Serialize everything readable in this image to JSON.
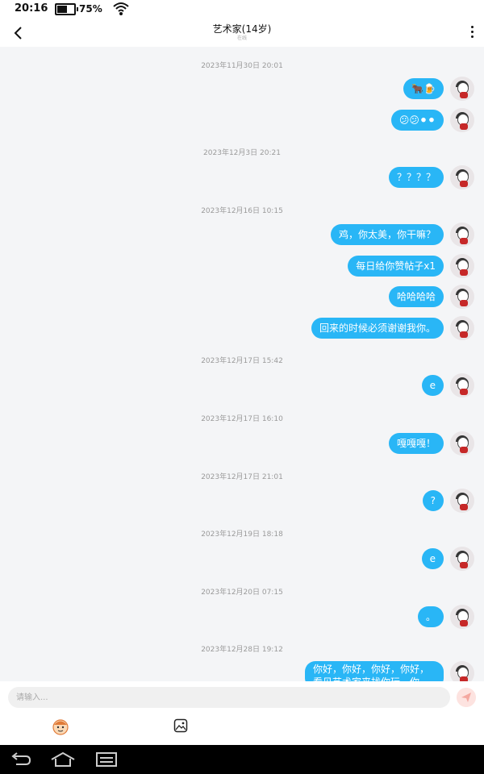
{
  "status_bar": {
    "time": "20:16",
    "battery": "75%"
  },
  "header": {
    "title": "艺术家(14岁)",
    "subtitle": "在线"
  },
  "chat": {
    "bubble_color": "#29b6f6",
    "entries": [
      {
        "type": "ts",
        "text": "2023年11月30日 20:01"
      },
      {
        "type": "msg",
        "text": "🐂🍺"
      },
      {
        "type": "msg",
        "text": "😕😕⚫⚫"
      },
      {
        "type": "ts",
        "text": "2023年12月3日 20:21"
      },
      {
        "type": "msg",
        "text": "？？？？"
      },
      {
        "type": "ts",
        "text": "2023年12月16日 10:15"
      },
      {
        "type": "msg",
        "text": "鸡，你太美，你干嘛？"
      },
      {
        "type": "msg",
        "text": "每日给你赞帖子x1"
      },
      {
        "type": "msg",
        "text": "哈哈哈哈"
      },
      {
        "type": "msg",
        "text": "回来的时候必须谢谢我你。"
      },
      {
        "type": "ts",
        "text": "2023年12月17日 15:42"
      },
      {
        "type": "msg",
        "text": "e"
      },
      {
        "type": "ts",
        "text": "2023年12月17日 16:10"
      },
      {
        "type": "msg",
        "text": "嘎嘎嘎！"
      },
      {
        "type": "ts",
        "text": "2023年12月17日 21:01"
      },
      {
        "type": "msg",
        "text": "?"
      },
      {
        "type": "ts",
        "text": "2023年12月19日 18:18"
      },
      {
        "type": "msg",
        "text": "e"
      },
      {
        "type": "ts",
        "text": "2023年12月20日 07:15"
      },
      {
        "type": "msg",
        "text": "。"
      },
      {
        "type": "ts",
        "text": "2023年12月28日 19:12"
      },
      {
        "type": "msg",
        "text": "你好，你好，你好，你好，看见艺术家来找你玩，你好，你"
      }
    ]
  },
  "composer": {
    "placeholder": "请输入...",
    "emoji_icon": "emoji-face-icon",
    "image_icon": "image-icon",
    "send_icon": "send-icon"
  },
  "nav": {
    "back_icon": "back-icon",
    "home_icon": "home-icon",
    "recents_icon": "recents-icon"
  }
}
